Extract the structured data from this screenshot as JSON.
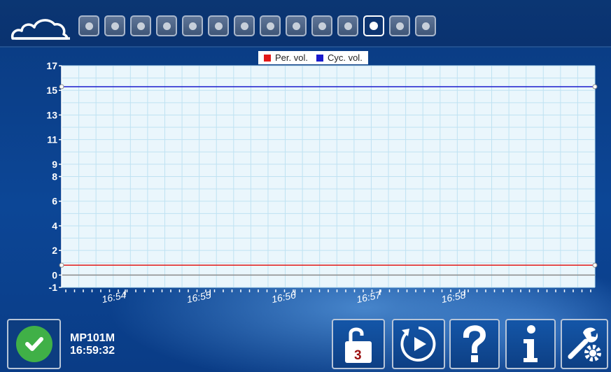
{
  "top_bar": {
    "page_count": 14,
    "active_page": 12
  },
  "device": {
    "name": "MP101M",
    "time": "16:59:32"
  },
  "lock_badge": "3",
  "colors": {
    "per_vol": "#e31919",
    "cyc_vol": "#1a1acc",
    "plot_bg": "#eaf6fc",
    "grid": "#bfe2f2"
  },
  "icons": [
    "cloud-icon",
    "check-icon",
    "unlock-icon",
    "play-cycle-icon",
    "question-icon",
    "info-icon",
    "tools-icon"
  ],
  "chart_data": {
    "type": "line",
    "title": "",
    "xlabel": "",
    "ylabel": "",
    "y_ticks": [
      "17",
      "15",
      "13",
      "11",
      "9",
      "8",
      "6",
      "4",
      "2",
      "0",
      "-1"
    ],
    "x_ticks": [
      "16:54",
      "16:55",
      "16:56",
      "16:57",
      "16:58"
    ],
    "ylim": [
      -1,
      17
    ],
    "xlim": [
      "16:53:15",
      "16:59:32"
    ],
    "grid": true,
    "legend": "top-center",
    "series": [
      {
        "name": "Per. vol.",
        "color": "#e31919",
        "x": [
          "16:53:15",
          "16:59:32"
        ],
        "y": [
          0.8,
          0.8
        ]
      },
      {
        "name": "Cyc. vol.",
        "color": "#1a1acc",
        "x": [
          "16:53:15",
          "16:59:32"
        ],
        "y": [
          15.3,
          15.3
        ]
      }
    ]
  }
}
